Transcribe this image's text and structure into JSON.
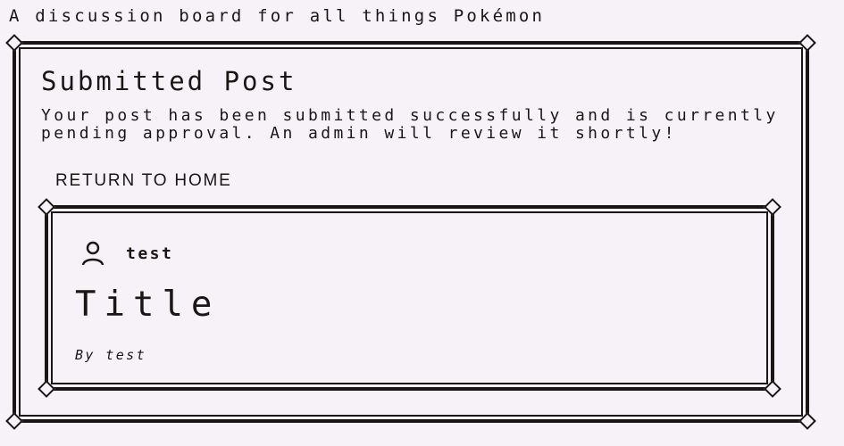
{
  "header": {
    "tagline": "A discussion board for all things Pokémon"
  },
  "submission": {
    "title": "Submitted Post",
    "message": "Your post has been submitted successfully and is currently pending approval. An admin will review it shortly!",
    "return_link_label": "RETURN TO HOME"
  },
  "post": {
    "author": "test",
    "author_icon": "user-icon",
    "title": "Title",
    "byline": "By test"
  }
}
